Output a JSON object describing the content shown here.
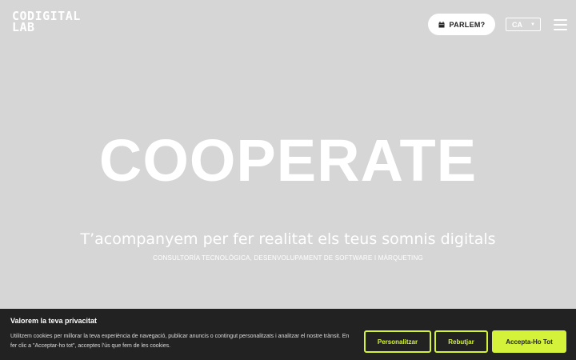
{
  "header": {
    "logo_line1": "CODIGITAL",
    "logo_line2": "LAB",
    "cta_label": "PARLEM?",
    "cta_icon": "calendar-icon",
    "language": "CA",
    "menu_icon": "hamburger-icon"
  },
  "hero": {
    "title": "COOPERATE",
    "subtitle": "T’acompanyem per fer realitat els teus somnis digitals",
    "tagline": "CONSULTORÍA TECNOLÒGICA, DESENVOLUPAMENT DE SOFTWARE I MÀRQUETING"
  },
  "cookie_banner": {
    "title": "Valorem la teva privacitat",
    "text": "Utilitzem cookies per millorar la teva experiència de navegació, publicar anuncis o contingut personalitzats i analitzar el nostre trànsit. En fer clic a \"Acceptar-ho tot\", acceptes l'ús que fem de les cookies.",
    "customize_label": "Personalitzar",
    "reject_label": "Rebutjar",
    "accept_label": "Accepta-Ho Tot"
  },
  "colors": {
    "background": "#d6d6d6",
    "accent": "#d4f23a",
    "banner": "#222222"
  }
}
